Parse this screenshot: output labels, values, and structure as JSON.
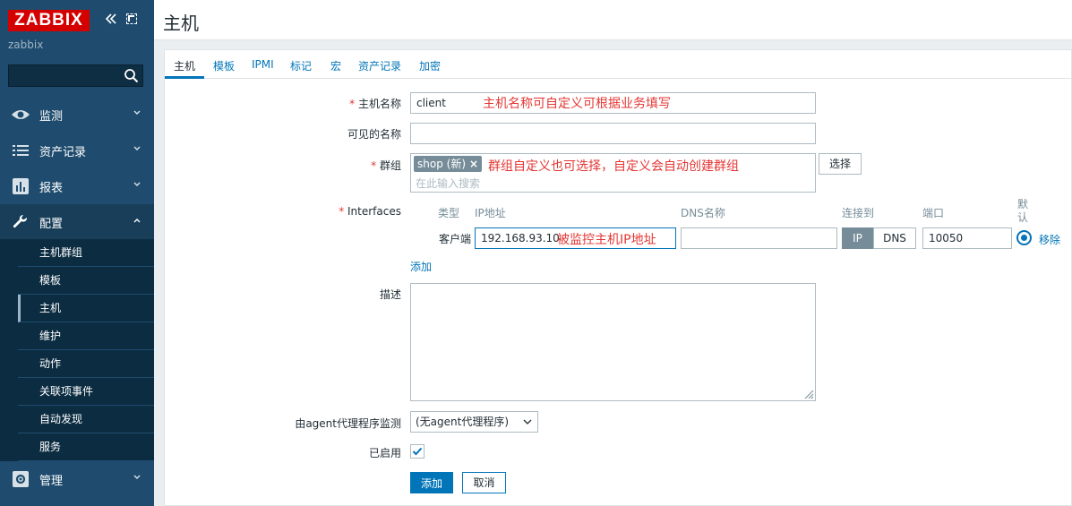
{
  "brand": {
    "logo_text": "ZABBIX",
    "site_name": "zabbix",
    "color": "#d40000"
  },
  "sidebar": {
    "menu": [
      {
        "id": "monitoring",
        "label": "监测",
        "icon": "eye-icon"
      },
      {
        "id": "inventory",
        "label": "资产记录",
        "icon": "list-icon"
      },
      {
        "id": "reports",
        "label": "报表",
        "icon": "bar-chart-icon"
      },
      {
        "id": "configuration",
        "label": "配置",
        "icon": "wrench-icon",
        "open": true
      },
      {
        "id": "administration",
        "label": "管理",
        "icon": "gear-icon"
      }
    ],
    "config_submenu": [
      {
        "label": "主机群组"
      },
      {
        "label": "模板"
      },
      {
        "label": "主机",
        "active": true
      },
      {
        "label": "维护"
      },
      {
        "label": "动作"
      },
      {
        "label": "关联项事件"
      },
      {
        "label": "自动发现"
      },
      {
        "label": "服务"
      }
    ]
  },
  "header": {
    "title": "主机"
  },
  "tabs": [
    "主机",
    "模板",
    "IPMI",
    "标记",
    "宏",
    "资产记录",
    "加密"
  ],
  "form": {
    "hostname": {
      "label": "主机名称",
      "required": "*",
      "value": "client",
      "note": "主机名称可自定义可根据业务填写"
    },
    "visible_name": {
      "label": "可见的名称",
      "value": ""
    },
    "groups": {
      "label": "群组",
      "required": "*",
      "tag": "shop (新)",
      "tag_remove": "×",
      "search_placeholder": "在此输入搜索",
      "note": "群组自定义也可选择，自定义会自动创建群组",
      "select_label": "选择"
    },
    "interfaces": {
      "label": "Interfaces",
      "required": "*",
      "headers": {
        "type": "类型",
        "ip": "IP地址",
        "dns": "DNS名称",
        "connect": "连接到",
        "port": "端口",
        "default": "默认"
      },
      "row": {
        "type": "客户端",
        "ip": "192.168.93.10",
        "ip_note": "被监控主机IP地址",
        "dns": "",
        "connect_ip": "IP",
        "connect_dns": "DNS",
        "port": "10050",
        "remove": "移除"
      },
      "add_link": "添加"
    },
    "description": {
      "label": "描述",
      "value": ""
    },
    "proxy": {
      "label": "由agent代理程序监测",
      "value": "(无agent代理程序)"
    },
    "enabled": {
      "label": "已启用",
      "checked": true
    },
    "buttons": {
      "add": "添加",
      "cancel": "取消"
    }
  },
  "colors": {
    "sidebar": "#1f4c6e",
    "accent": "#0275b8",
    "annotation": "#e33734"
  }
}
